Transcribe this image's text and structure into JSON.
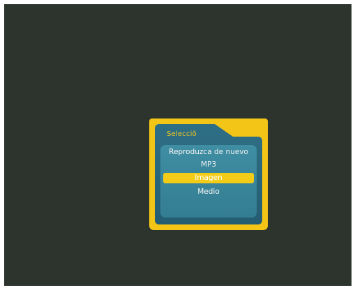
{
  "dialog": {
    "title": "Selecciõ",
    "menu_items": [
      {
        "label": "Reproduzca de nuevo",
        "selected": false
      },
      {
        "label": "MP3",
        "selected": false
      },
      {
        "label": "Imagen",
        "selected": true
      },
      {
        "label": "Medio",
        "selected": false
      }
    ]
  },
  "colors": {
    "background": "#2d332d",
    "frame": "#f3c516",
    "panel": "#347d92",
    "highlight": "#f3cc18",
    "text": "#f4f4f4",
    "title_text": "#f2c81e"
  }
}
